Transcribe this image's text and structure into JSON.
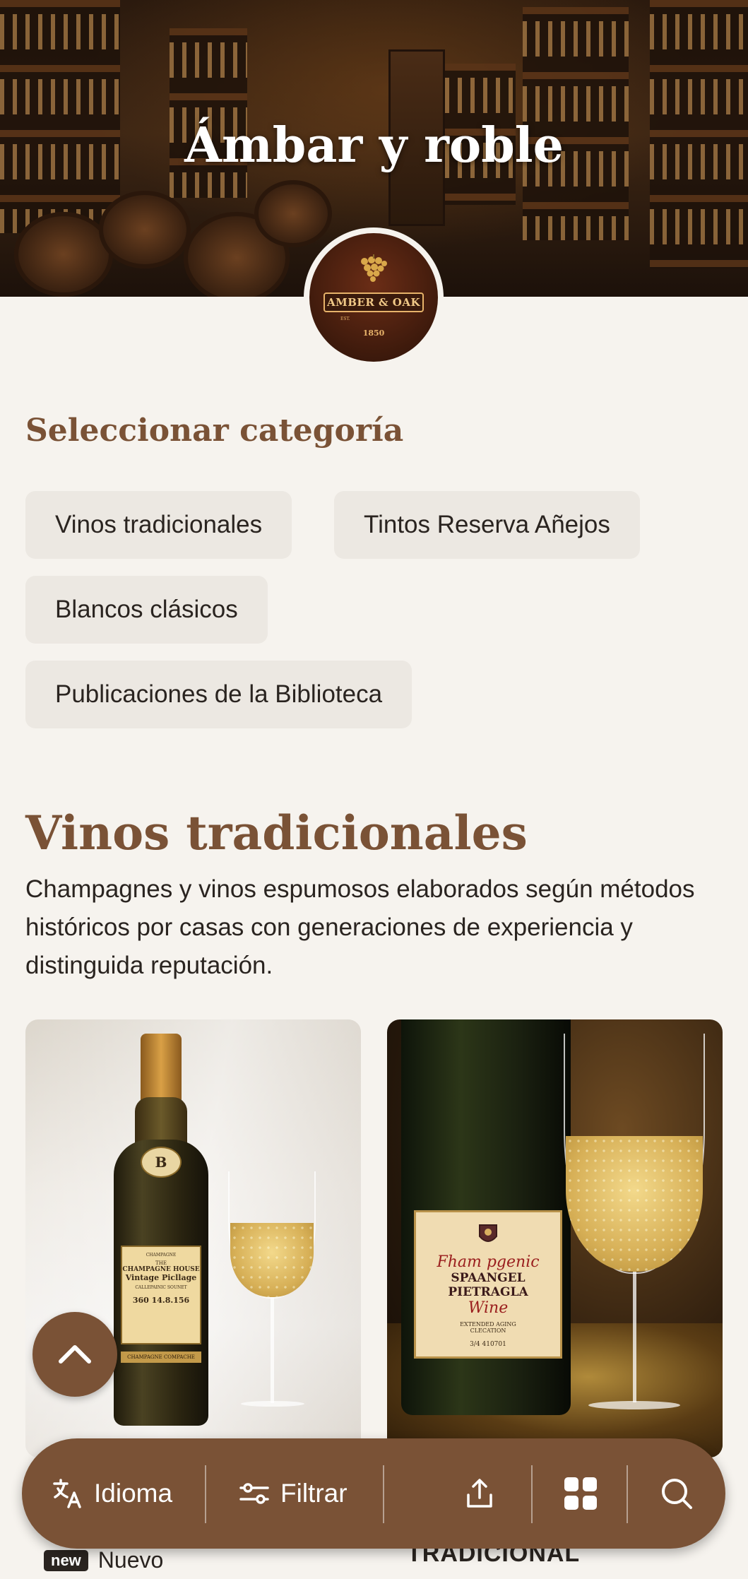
{
  "hero": {
    "title": "Ámbar y roble"
  },
  "logo": {
    "banner": "AMBER & OAK",
    "year": "1850",
    "est": "EST."
  },
  "categories": {
    "heading": "Seleccionar categoría",
    "items": [
      {
        "label": "Vinos tradicionales"
      },
      {
        "label": "Tintos Reserva Añejos"
      },
      {
        "label": "Blancos clásicos"
      },
      {
        "label": "Publicaciones de la Biblioteca"
      }
    ]
  },
  "section": {
    "title": "Vinos tradicionales",
    "description": "Champagnes y vinos espumosos elaborados según métodos históricos por casas con generaciones de experiencia y distinguida reputación."
  },
  "products": [
    {
      "label_lines": [
        "CHAMPAGNE",
        "THE",
        "CHAMPAGNE HOUSE",
        "Vintage Picllage",
        "CALLEPAINIC SOUNET",
        "360   14.8.156"
      ],
      "bottom_band": "CHAMPAGNE COMPACHE",
      "badge_letter": "B",
      "badge": "new",
      "badge_text": "Nuevo"
    },
    {
      "label_lines": [
        "Fham pgenic",
        "SPAANGEL PIETRAGLA",
        "Wine",
        "EXTENDED AGING",
        "CLECATION",
        "3/4 410701"
      ],
      "tag": "TRADICIONAL"
    }
  ],
  "nav": {
    "language": "Idioma",
    "filter": "Filtrar",
    "icons": [
      "translate-icon",
      "filter-icon",
      "share-icon",
      "grid-icon",
      "search-icon",
      "chevron-up-icon"
    ]
  },
  "colors": {
    "accent": "#7a5236",
    "background": "#f6f3ee",
    "chip": "#ece8e2"
  }
}
